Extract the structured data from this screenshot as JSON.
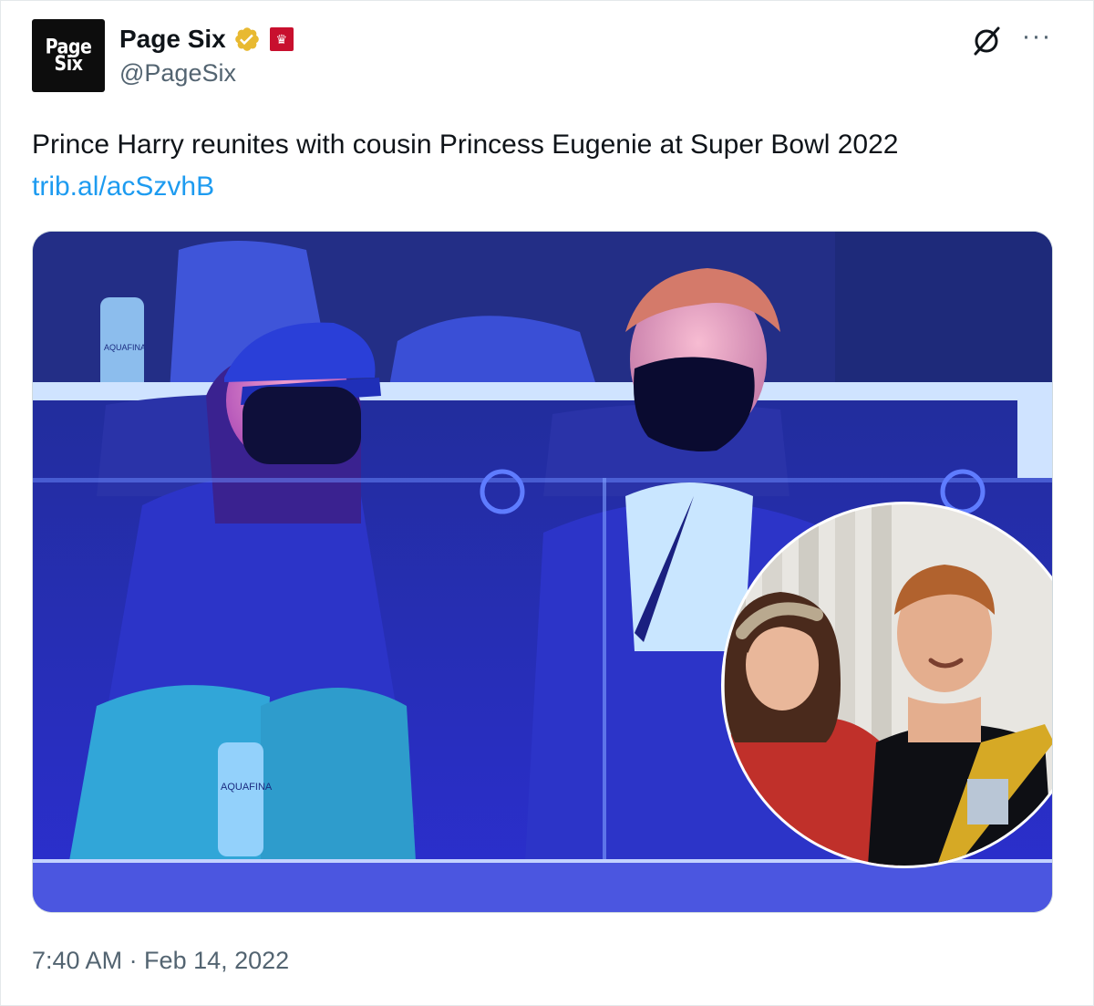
{
  "author": {
    "display_name": "Page Six",
    "handle": "@PageSix",
    "avatar_text_line1": "Page",
    "avatar_text_line2": "Six",
    "verified": true,
    "verified_color": "#e8b931"
  },
  "tweet": {
    "text": "Prince Harry reunites with cousin Princess Eugenie at Super Bowl 2022",
    "link": "trib.al/acSzvhB",
    "timestamp": "7:40 AM · Feb 14, 2022"
  },
  "media": {
    "bottle_label_left": "AQUAFINA",
    "bottle_label_bottom": "AQUAFINA"
  },
  "icons": {
    "grok": "grok-icon",
    "more": "more-icon",
    "verified": "verified-badge-icon",
    "affiliate": "affiliate-badge-icon"
  },
  "colors": {
    "link": "#1d9bf0",
    "secondary_text": "#536471",
    "scene_blue": "#2f2fd8"
  }
}
